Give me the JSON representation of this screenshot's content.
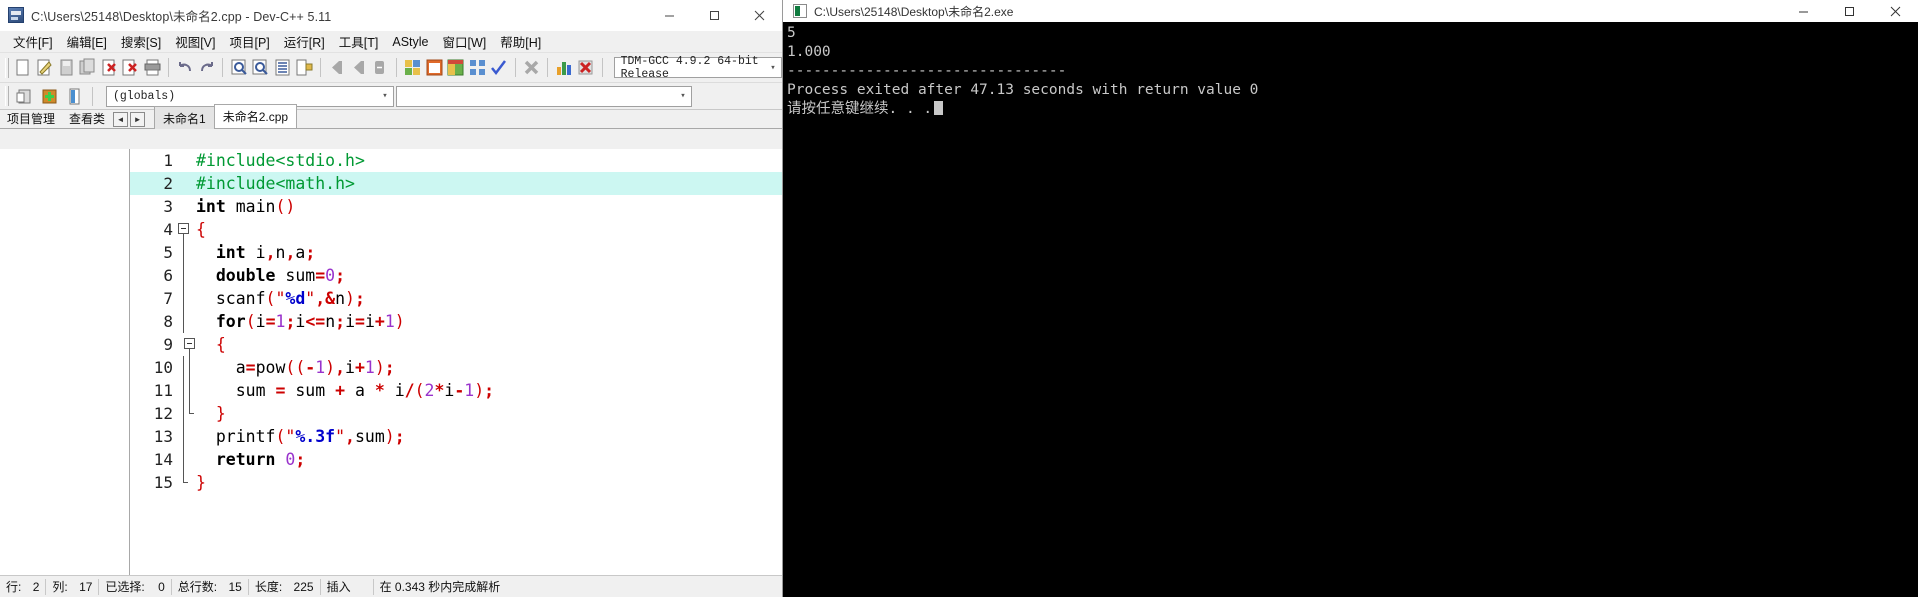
{
  "ide": {
    "title": "C:\\Users\\25148\\Desktop\\未命名2.cpp - Dev-C++ 5.11",
    "window_controls": {
      "minimize": "–",
      "maximize": "□",
      "close": "✕"
    },
    "menu": [
      "文件[F]",
      "编辑[E]",
      "搜索[S]",
      "视图[V]",
      "项目[P]",
      "运行[R]",
      "工具[T]",
      "AStyle",
      "窗口[W]",
      "帮助[H]"
    ],
    "compiler_combo": {
      "value": "TDM-GCC 4.9.2 64-bit Release"
    },
    "globals_combo": {
      "value": "(globals)"
    },
    "symbols_combo": {
      "value": ""
    },
    "panel_tabs": [
      {
        "label": "项目管理",
        "active": true
      },
      {
        "label": "查看类",
        "active": false
      }
    ],
    "nav_arrows": {
      "prev": "◄",
      "next": "►"
    },
    "editor_tabs": [
      {
        "label": "未命名1",
        "active": false
      },
      {
        "label": "未命名2.cpp",
        "active": true
      }
    ],
    "statusbar": {
      "row_label": "行:",
      "row_value": "2",
      "col_label": "列:",
      "col_value": "17",
      "sel_label": "已选择:",
      "sel_value": "0",
      "lines_label": "总行数:",
      "lines_value": "15",
      "len_label": "长度:",
      "len_value": "225",
      "insert_mode": "插入",
      "parse_status": "在 0.343 秒内完成解析"
    },
    "toolbar_icons": [
      "new-file-icon",
      "open-file-icon",
      "save-icon",
      "save-all-icon",
      "close-file-icon",
      "close-all-icon",
      "print-icon",
      "undo-icon",
      "redo-icon",
      "find-icon",
      "find-next-icon",
      "goto-line-icon",
      "replace-icon",
      "step-back-icon",
      "step-forward-icon",
      "stop-icon",
      "compile-icon",
      "run-icon",
      "compile-run-icon",
      "rebuild-icon",
      "check-syntax-icon",
      "remove-icon",
      "profile-icon",
      "debug-icon"
    ],
    "toolbar2_icons": [
      "insert-icon",
      "toggle-icon",
      "goto-function-icon"
    ]
  },
  "code": {
    "highlight_line": 2,
    "lines": [
      {
        "n": "1",
        "fold": "none",
        "tokens": [
          {
            "t": "#include<stdio.h>",
            "c": "pp"
          }
        ]
      },
      {
        "n": "2",
        "fold": "none",
        "tokens": [
          {
            "t": "#include<math.h>",
            "c": "pp"
          }
        ]
      },
      {
        "n": "3",
        "fold": "none",
        "tokens": [
          {
            "t": "int",
            "c": "k"
          },
          {
            "t": " main",
            "c": "pl"
          },
          {
            "t": "()",
            "c": "br"
          }
        ]
      },
      {
        "n": "4",
        "fold": "start",
        "tokens": [
          {
            "t": "{",
            "c": "br"
          }
        ]
      },
      {
        "n": "5",
        "fold": "bar",
        "tokens": [
          {
            "t": "  ",
            "c": "pl"
          },
          {
            "t": "int",
            "c": "k"
          },
          {
            "t": " i",
            "c": "pl"
          },
          {
            "t": ",",
            "c": "sy"
          },
          {
            "t": "n",
            "c": "pl"
          },
          {
            "t": ",",
            "c": "sy"
          },
          {
            "t": "a",
            "c": "pl"
          },
          {
            "t": ";",
            "c": "sy"
          }
        ]
      },
      {
        "n": "6",
        "fold": "bar",
        "tokens": [
          {
            "t": "  ",
            "c": "pl"
          },
          {
            "t": "double",
            "c": "k"
          },
          {
            "t": " sum",
            "c": "pl"
          },
          {
            "t": "=",
            "c": "sy"
          },
          {
            "t": "0",
            "c": "nu"
          },
          {
            "t": ";",
            "c": "sy"
          }
        ]
      },
      {
        "n": "7",
        "fold": "bar",
        "tokens": [
          {
            "t": "  scanf",
            "c": "pl"
          },
          {
            "t": "(",
            "c": "br"
          },
          {
            "t": "\"",
            "c": "qt"
          },
          {
            "t": "%d",
            "c": "st"
          },
          {
            "t": "\"",
            "c": "qt"
          },
          {
            "t": ",",
            "c": "sy"
          },
          {
            "t": "&",
            "c": "sy"
          },
          {
            "t": "n",
            "c": "pl"
          },
          {
            "t": ")",
            "c": "br"
          },
          {
            "t": ";",
            "c": "sy"
          }
        ]
      },
      {
        "n": "8",
        "fold": "bar",
        "tokens": [
          {
            "t": "  ",
            "c": "pl"
          },
          {
            "t": "for",
            "c": "k"
          },
          {
            "t": "(",
            "c": "br"
          },
          {
            "t": "i",
            "c": "pl"
          },
          {
            "t": "=",
            "c": "sy"
          },
          {
            "t": "1",
            "c": "nu"
          },
          {
            "t": ";",
            "c": "sy"
          },
          {
            "t": "i",
            "c": "pl"
          },
          {
            "t": "<=",
            "c": "sy"
          },
          {
            "t": "n",
            "c": "pl"
          },
          {
            "t": ";",
            "c": "sy"
          },
          {
            "t": "i",
            "c": "pl"
          },
          {
            "t": "=",
            "c": "sy"
          },
          {
            "t": "i",
            "c": "pl"
          },
          {
            "t": "+",
            "c": "sy"
          },
          {
            "t": "1",
            "c": "nu"
          },
          {
            "t": ")",
            "c": "br"
          }
        ]
      },
      {
        "n": "9",
        "fold": "start2",
        "tokens": [
          {
            "t": "  ",
            "c": "pl"
          },
          {
            "t": "{",
            "c": "br"
          }
        ]
      },
      {
        "n": "10",
        "fold": "bar2",
        "tokens": [
          {
            "t": "    a",
            "c": "pl"
          },
          {
            "t": "=",
            "c": "sy"
          },
          {
            "t": "pow",
            "c": "pl"
          },
          {
            "t": "((",
            "c": "br"
          },
          {
            "t": "-",
            "c": "sy"
          },
          {
            "t": "1",
            "c": "nu"
          },
          {
            "t": ")",
            "c": "br"
          },
          {
            "t": ",",
            "c": "sy"
          },
          {
            "t": "i",
            "c": "pl"
          },
          {
            "t": "+",
            "c": "sy"
          },
          {
            "t": "1",
            "c": "nu"
          },
          {
            "t": ")",
            "c": "br"
          },
          {
            "t": ";",
            "c": "sy"
          }
        ]
      },
      {
        "n": "11",
        "fold": "bar2",
        "tokens": [
          {
            "t": "    sum ",
            "c": "pl"
          },
          {
            "t": "=",
            "c": "sy"
          },
          {
            "t": " sum ",
            "c": "pl"
          },
          {
            "t": "+",
            "c": "sy"
          },
          {
            "t": " a ",
            "c": "pl"
          },
          {
            "t": "*",
            "c": "sy"
          },
          {
            "t": " i",
            "c": "pl"
          },
          {
            "t": "/",
            "c": "sy"
          },
          {
            "t": "(",
            "c": "br"
          },
          {
            "t": "2",
            "c": "nu"
          },
          {
            "t": "*",
            "c": "sy"
          },
          {
            "t": "i",
            "c": "pl"
          },
          {
            "t": "-",
            "c": "sy"
          },
          {
            "t": "1",
            "c": "nu"
          },
          {
            "t": ")",
            "c": "br"
          },
          {
            "t": ";",
            "c": "sy"
          }
        ]
      },
      {
        "n": "12",
        "fold": "end2",
        "tokens": [
          {
            "t": "  ",
            "c": "pl"
          },
          {
            "t": "}",
            "c": "br"
          }
        ]
      },
      {
        "n": "13",
        "fold": "bar",
        "tokens": [
          {
            "t": "  printf",
            "c": "pl"
          },
          {
            "t": "(",
            "c": "br"
          },
          {
            "t": "\"",
            "c": "qt"
          },
          {
            "t": "%.3f",
            "c": "st"
          },
          {
            "t": "\"",
            "c": "qt"
          },
          {
            "t": ",",
            "c": "sy"
          },
          {
            "t": "sum",
            "c": "pl"
          },
          {
            "t": ")",
            "c": "br"
          },
          {
            "t": ";",
            "c": "sy"
          }
        ]
      },
      {
        "n": "14",
        "fold": "bar",
        "tokens": [
          {
            "t": "  ",
            "c": "pl"
          },
          {
            "t": "return",
            "c": "k"
          },
          {
            "t": " ",
            "c": "pl"
          },
          {
            "t": "0",
            "c": "nu"
          },
          {
            "t": ";",
            "c": "sy"
          }
        ]
      },
      {
        "n": "15",
        "fold": "end",
        "tokens": [
          {
            "t": "}",
            "c": "br"
          }
        ]
      }
    ]
  },
  "console": {
    "title": "C:\\Users\\25148\\Desktop\\未命名2.exe",
    "window_controls": {
      "minimize": "–",
      "maximize": "□",
      "close": "✕"
    },
    "output": [
      "5",
      "1.000",
      "--------------------------------",
      "Process exited after 47.13 seconds with return value 0",
      "请按任意键继续. . ."
    ]
  },
  "colors": {
    "highlight_line_bg": "#ccf7f2",
    "preprocessor": "#009933",
    "string": "#0000cc",
    "symbol": "#cc0000",
    "number": "#9933cc",
    "console_bg": "#000000",
    "console_fg": "#c8c8c8"
  }
}
